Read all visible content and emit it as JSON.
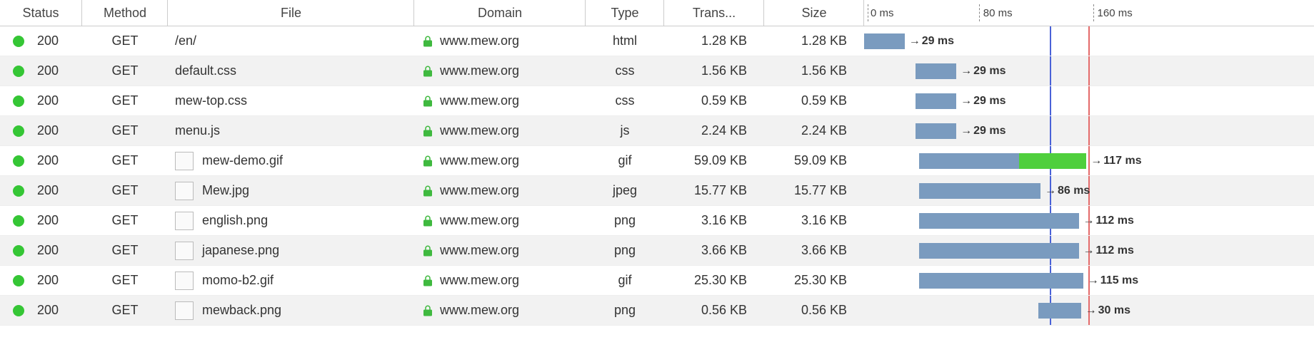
{
  "columns": {
    "status": "Status",
    "method": "Method",
    "file": "File",
    "domain": "Domain",
    "type": "Type",
    "trans": "Trans...",
    "size": "Size"
  },
  "timeline": {
    "ticks": [
      {
        "label": "0 ms",
        "pos_pct": 0
      },
      {
        "label": "80 ms",
        "pos_pct": 25.4
      },
      {
        "label": "160 ms",
        "pos_pct": 50.8
      }
    ],
    "marker_blue_pct": 41.2,
    "marker_red_pct": 49.8
  },
  "rows": [
    {
      "status": "200",
      "status_color": "#35c635",
      "method": "GET",
      "file": "/en/",
      "has_thumb": false,
      "domain": "www.mew.org",
      "type": "html",
      "trans": "1.28 KB",
      "size": "1.28 KB",
      "bar_start_pct": 0.0,
      "bar_width_pct": 9.0,
      "green_width_pct": 0,
      "duration": "29 ms"
    },
    {
      "status": "200",
      "status_color": "#35c635",
      "method": "GET",
      "file": "default.css",
      "has_thumb": false,
      "domain": "www.mew.org",
      "type": "css",
      "trans": "1.56 KB",
      "size": "1.56 KB",
      "bar_start_pct": 11.5,
      "bar_width_pct": 9.0,
      "green_width_pct": 0,
      "duration": "29 ms"
    },
    {
      "status": "200",
      "status_color": "#35c635",
      "method": "GET",
      "file": "mew-top.css",
      "has_thumb": false,
      "domain": "www.mew.org",
      "type": "css",
      "trans": "0.59 KB",
      "size": "0.59 KB",
      "bar_start_pct": 11.5,
      "bar_width_pct": 9.0,
      "green_width_pct": 0,
      "duration": "29 ms"
    },
    {
      "status": "200",
      "status_color": "#35c635",
      "method": "GET",
      "file": "menu.js",
      "has_thumb": false,
      "domain": "www.mew.org",
      "type": "js",
      "trans": "2.24 KB",
      "size": "2.24 KB",
      "bar_start_pct": 11.5,
      "bar_width_pct": 9.0,
      "green_width_pct": 0,
      "duration": "29 ms"
    },
    {
      "status": "200",
      "status_color": "#35c635",
      "method": "GET",
      "file": "mew-demo.gif",
      "has_thumb": true,
      "domain": "www.mew.org",
      "type": "gif",
      "trans": "59.09 KB",
      "size": "59.09 KB",
      "bar_start_pct": 12.2,
      "bar_width_pct": 37.2,
      "green_width_pct": 14.9,
      "duration": "117 ms"
    },
    {
      "status": "200",
      "status_color": "#35c635",
      "method": "GET",
      "file": "Mew.jpg",
      "has_thumb": true,
      "domain": "www.mew.org",
      "type": "jpeg",
      "trans": "15.77 KB",
      "size": "15.77 KB",
      "bar_start_pct": 12.2,
      "bar_width_pct": 27.0,
      "green_width_pct": 0,
      "duration": "86 ms"
    },
    {
      "status": "200",
      "status_color": "#35c635",
      "method": "GET",
      "file": "english.png",
      "has_thumb": true,
      "domain": "www.mew.org",
      "type": "png",
      "trans": "3.16 KB",
      "size": "3.16 KB",
      "bar_start_pct": 12.2,
      "bar_width_pct": 35.5,
      "green_width_pct": 0,
      "duration": "112 ms"
    },
    {
      "status": "200",
      "status_color": "#35c635",
      "method": "GET",
      "file": "japanese.png",
      "has_thumb": true,
      "domain": "www.mew.org",
      "type": "png",
      "trans": "3.66 KB",
      "size": "3.66 KB",
      "bar_start_pct": 12.2,
      "bar_width_pct": 35.5,
      "green_width_pct": 0,
      "duration": "112 ms"
    },
    {
      "status": "200",
      "status_color": "#35c635",
      "method": "GET",
      "file": "momo-b2.gif",
      "has_thumb": true,
      "domain": "www.mew.org",
      "type": "gif",
      "trans": "25.30 KB",
      "size": "25.30 KB",
      "bar_start_pct": 12.2,
      "bar_width_pct": 36.5,
      "green_width_pct": 0,
      "duration": "115 ms"
    },
    {
      "status": "200",
      "status_color": "#35c635",
      "method": "GET",
      "file": "mewback.png",
      "has_thumb": true,
      "domain": "www.mew.org",
      "type": "png",
      "trans": "0.56 KB",
      "size": "0.56 KB",
      "bar_start_pct": 38.7,
      "bar_width_pct": 9.5,
      "green_width_pct": 0,
      "duration": "30 ms"
    }
  ]
}
